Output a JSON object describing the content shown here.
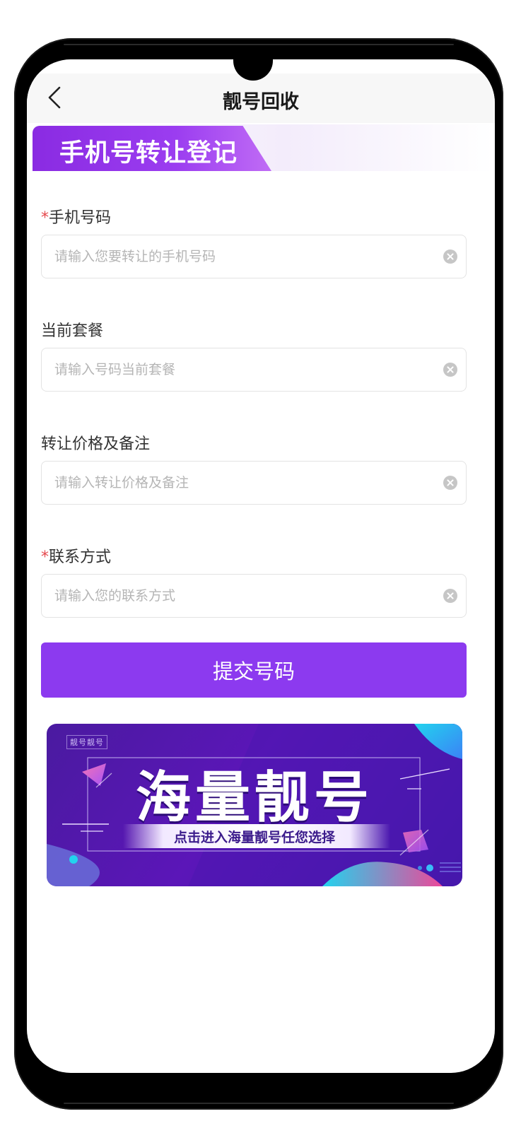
{
  "navbar": {
    "back_icon": "chevron-left-icon",
    "title": "靓号回收"
  },
  "section_title": "手机号转让登记",
  "required_marker": "*",
  "form": {
    "fields": [
      {
        "label": "手机号码",
        "required": true,
        "placeholder": "请输入您要转让的手机号码",
        "value": ""
      },
      {
        "label": "当前套餐",
        "required": false,
        "placeholder": "请输入号码当前套餐",
        "value": ""
      },
      {
        "label": "转让价格及备注",
        "required": false,
        "placeholder": "请输入转让价格及备注",
        "value": ""
      },
      {
        "label": "联系方式",
        "required": true,
        "placeholder": "请输入您的联系方式",
        "value": ""
      }
    ],
    "clear_icon": "clear-circle-icon",
    "submit_label": "提交号码"
  },
  "promo": {
    "corner_text": "靓号靓号",
    "headline": "海量靓号",
    "subtitle": "点击进入海量靓号任您选择"
  },
  "colors": {
    "accent": "#8c3aef",
    "required": "#e5484d",
    "promo_bg": "#5b16b8"
  }
}
